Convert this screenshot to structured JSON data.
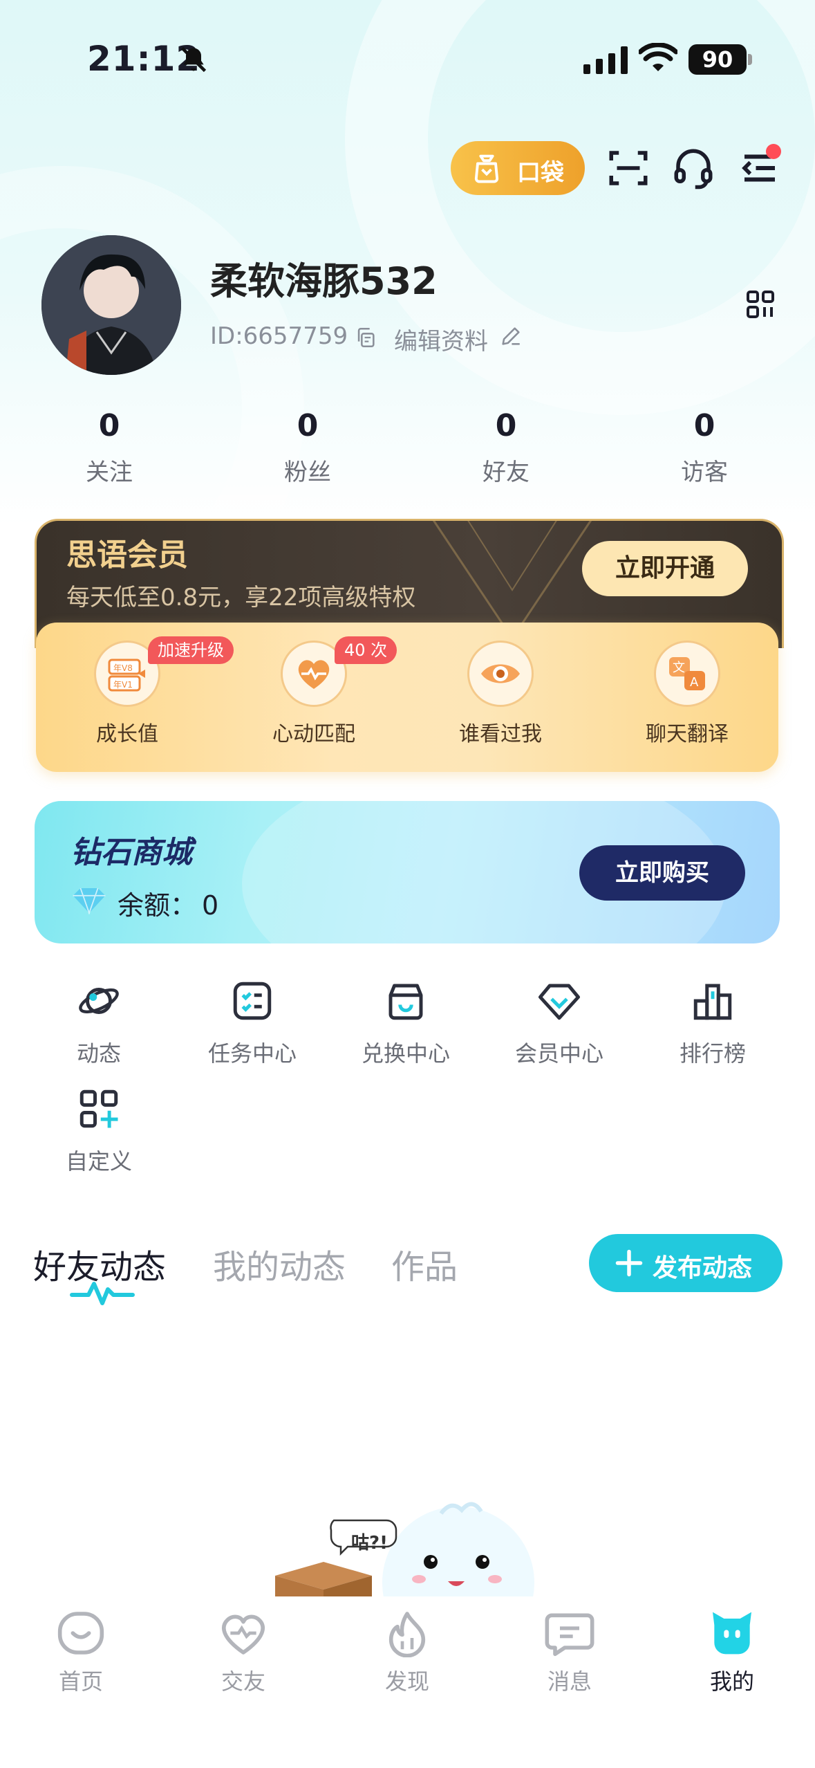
{
  "status_bar": {
    "time": "21:12",
    "battery": "90"
  },
  "header": {
    "pocket_label": "口袋"
  },
  "profile": {
    "nickname": "柔软海豚532",
    "user_id": "ID:6657759",
    "edit_label": "编辑资料"
  },
  "stats": [
    {
      "value": "0",
      "label": "关注"
    },
    {
      "value": "0",
      "label": "粉丝"
    },
    {
      "value": "0",
      "label": "好友"
    },
    {
      "value": "0",
      "label": "访客"
    }
  ],
  "vip": {
    "title": "思语会员",
    "subtitle": "每天低至0.8元，享22项高级特权",
    "button": "立即开通",
    "perks": [
      {
        "label": "成长值",
        "tag": "加速升级",
        "icon": "level-badge-icon"
      },
      {
        "label": "心动匹配",
        "tag": "40 次",
        "icon": "heart-pulse-icon"
      },
      {
        "label": "谁看过我",
        "tag": "",
        "icon": "eye-icon"
      },
      {
        "label": "聊天翻译",
        "tag": "",
        "icon": "translate-icon"
      }
    ]
  },
  "diamond": {
    "title": "钻石商城",
    "balance_label": "余额：",
    "balance_value": "0",
    "button": "立即购买"
  },
  "shortcuts": [
    {
      "label": "动态",
      "icon": "planet-icon"
    },
    {
      "label": "任务中心",
      "icon": "task-list-icon"
    },
    {
      "label": "兑换中心",
      "icon": "shop-icon"
    },
    {
      "label": "会员中心",
      "icon": "vip-gem-icon"
    },
    {
      "label": "排行榜",
      "icon": "podium-icon"
    },
    {
      "label": "自定义",
      "icon": "grid-plus-icon"
    }
  ],
  "feed_tabs": {
    "tabs": [
      "好友动态",
      "我的动态",
      "作品"
    ],
    "active": "好友动态",
    "post_button": "发布动态"
  },
  "empty_bubble": "咕?!",
  "bottom_nav": [
    {
      "label": "首页",
      "icon": "home-icon"
    },
    {
      "label": "交友",
      "icon": "heart-icon"
    },
    {
      "label": "发现",
      "icon": "flame-icon"
    },
    {
      "label": "消息",
      "icon": "message-icon"
    },
    {
      "label": "我的",
      "icon": "profile-cat-icon",
      "active": true
    }
  ],
  "colors": {
    "accent": "#22c9dd",
    "vip_gold": "#f2d08e",
    "diamond_button": "#1f2a66",
    "pocket_orange": "#eea12b",
    "badge_red": "#f2585a"
  }
}
